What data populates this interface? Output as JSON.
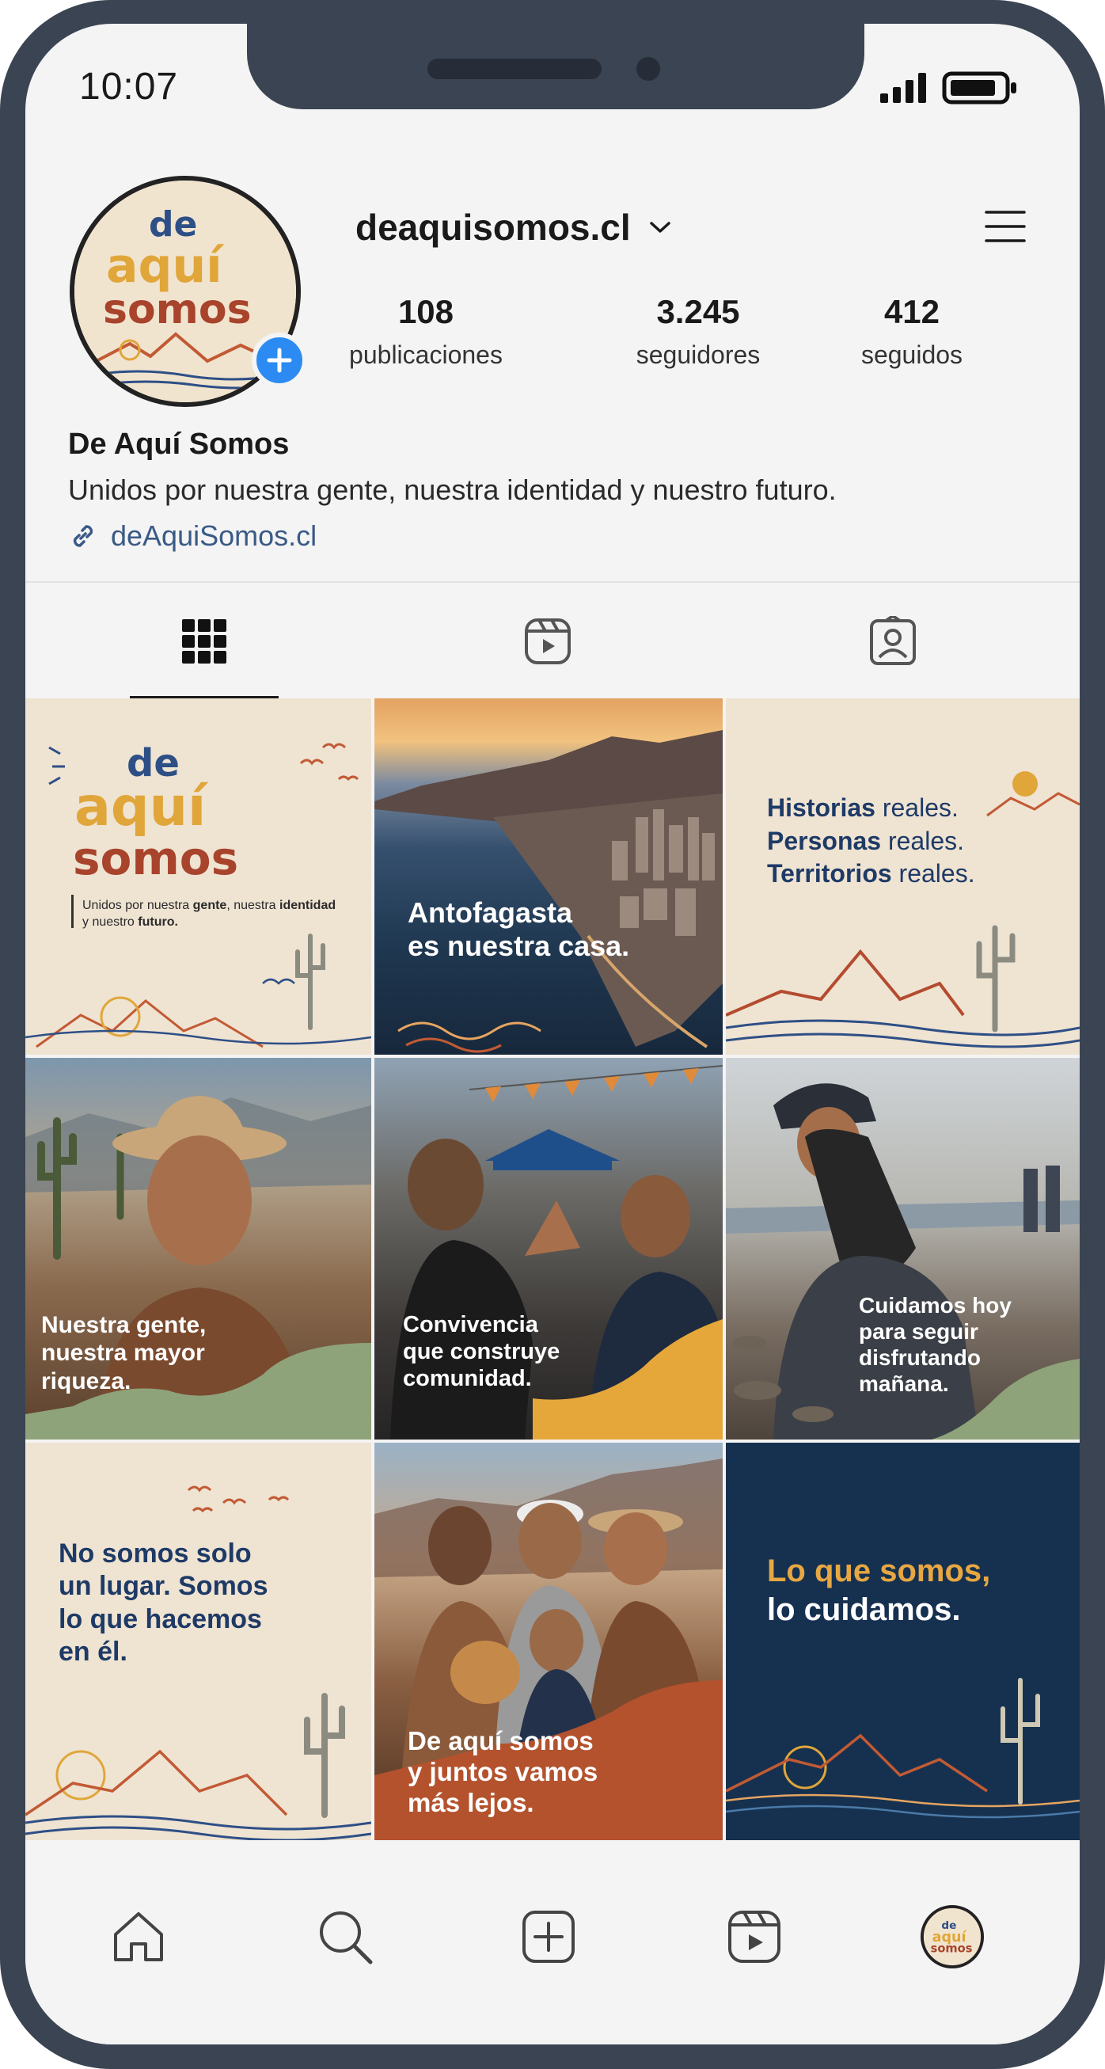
{
  "status_bar": {
    "time": "10:07"
  },
  "profile": {
    "username": "deaquisomos.cl",
    "display_name": "De Aquí Somos",
    "bio": "Unidos por nuestra gente, nuestra identidad y nuestro futuro.",
    "link": "deAquiSomos.cl",
    "stats": {
      "posts": {
        "value": "108",
        "label": "publicaciones"
      },
      "followers": {
        "value": "3.245",
        "label": "seguidores"
      },
      "following": {
        "value": "412",
        "label": "seguidos"
      }
    },
    "logo": {
      "line1": "de",
      "line2": "aquí",
      "line3": "somos"
    }
  },
  "tabs": [
    {
      "name": "grid",
      "icon": "grid-icon",
      "active": true
    },
    {
      "name": "reels",
      "icon": "reels-icon",
      "active": false
    },
    {
      "name": "tagged",
      "icon": "tagged-user-icon",
      "active": false
    }
  ],
  "posts": [
    {
      "id": "post-1",
      "logo": {
        "line1": "de",
        "line2": "aquí",
        "line3": "somos"
      },
      "subtitle_part1": "Unidos por nuestra ",
      "subtitle_bold1": "gente",
      "subtitle_part2": ", nuestra ",
      "subtitle_bold2": "identidad",
      "subtitle_part3": " y nuestro ",
      "subtitle_bold3": "futuro."
    },
    {
      "id": "post-2",
      "caption": [
        "Antofagasta",
        "es nuestra casa."
      ]
    },
    {
      "id": "post-3",
      "lines": [
        {
          "bold": "Historias",
          "rest": " reales."
        },
        {
          "bold": "Personas",
          "rest": " reales."
        },
        {
          "bold": "Territorios",
          "rest": " reales."
        }
      ]
    },
    {
      "id": "post-4",
      "caption": [
        "Nuestra gente,",
        "nuestra mayor",
        "riqueza."
      ]
    },
    {
      "id": "post-5",
      "caption": [
        "Convivencia",
        "que construye",
        "comunidad."
      ]
    },
    {
      "id": "post-6",
      "caption": [
        "Cuidamos hoy",
        "para seguir",
        "disfrutando",
        "mañana."
      ]
    },
    {
      "id": "post-7",
      "caption": [
        "No somos solo",
        "un lugar. Somos",
        "lo que hacemos",
        "en él."
      ]
    },
    {
      "id": "post-8",
      "caption": [
        "De aquí somos",
        "y juntos vamos",
        "más lejos."
      ]
    },
    {
      "id": "post-9",
      "caption_accent": "Lo que somos,",
      "caption_main": "lo cuidamos."
    }
  ],
  "bottom_nav": [
    {
      "name": "home",
      "icon": "home-icon"
    },
    {
      "name": "search",
      "icon": "search-icon"
    },
    {
      "name": "create",
      "icon": "add-post-icon"
    },
    {
      "name": "reels",
      "icon": "reels-icon"
    },
    {
      "name": "profile",
      "icon": "profile-avatar-icon"
    }
  ],
  "colors": {
    "accent_blue": "#2b8bf2",
    "link": "#3a5a86",
    "logo_blue": "#2d4f86",
    "logo_yellow": "#e0a63a",
    "logo_green": "#5e7a4a",
    "logo_red": "#a8432c",
    "navy": "#16314f",
    "cream": "#efe3d2"
  }
}
